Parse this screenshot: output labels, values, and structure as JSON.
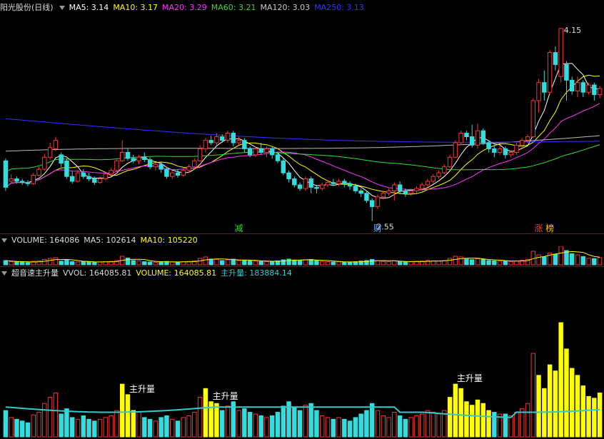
{
  "price_panel": {
    "title": "阳光股份(日线)",
    "ma": [
      {
        "label": "MA5: 3.14",
        "color": "#ffffff"
      },
      {
        "label": "MA10: 3.17",
        "color": "#ffff00"
      },
      {
        "label": "MA20: 3.29",
        "color": "#ff33ff"
      },
      {
        "label": "MA60: 3.21",
        "color": "#33dd33"
      },
      {
        "label": "MA120: 3.03",
        "color": "#cccccc"
      },
      {
        "label": "MA250: 3.13",
        "color": "#3333ff"
      }
    ],
    "high_label": "4.15",
    "low_label": "2.55",
    "markers": [
      {
        "text": "减",
        "color": "#33dd33",
        "idx": 42
      },
      {
        "text": "财",
        "color": "#66aaff",
        "idx": 67
      },
      {
        "text": "涨",
        "color": "#ff4444",
        "idx": 96
      },
      {
        "text": "榜",
        "color": "#ffcc00",
        "idx": 98
      }
    ]
  },
  "volume_panel": {
    "labels": [
      {
        "text": "VOLUME: 164086",
        "color": "#dddddd"
      },
      {
        "text": "MA5: 102614",
        "color": "#dddddd"
      },
      {
        "text": "MA10: 105220",
        "color": "#ffff00"
      }
    ]
  },
  "indicator_panel": {
    "labels": [
      {
        "text": "超音速主升量",
        "color": "#dddddd"
      },
      {
        "text": "VVOL: 164085.81",
        "color": "#dddddd"
      },
      {
        "text": "VOLUME: 164085.81",
        "color": "#ffff00"
      },
      {
        "text": "主升量: 183884.14",
        "color": "#33cccc"
      }
    ],
    "signal_label": "主升量",
    "signal_idx": [
      22,
      37,
      81
    ]
  },
  "chart_data": {
    "type": "candlestick",
    "ohlc": [
      [
        3.05,
        2.83,
        3.07,
        2.8
      ],
      [
        2.88,
        2.9,
        2.94,
        2.86
      ],
      [
        2.9,
        2.88,
        2.92,
        2.86
      ],
      [
        2.88,
        2.87,
        2.9,
        2.85
      ],
      [
        2.87,
        2.86,
        2.89,
        2.84
      ],
      [
        2.86,
        2.93,
        2.95,
        2.85
      ],
      [
        2.93,
        2.98,
        3.0,
        2.92
      ],
      [
        2.98,
        3.08,
        3.11,
        2.97
      ],
      [
        3.08,
        3.16,
        3.2,
        3.06
      ],
      [
        3.15,
        3.22,
        3.25,
        3.13
      ],
      [
        3.1,
        3.03,
        3.12,
        3.0
      ],
      [
        3.05,
        2.92,
        3.07,
        2.9
      ],
      [
        2.92,
        2.88,
        2.96,
        2.86
      ],
      [
        2.88,
        2.95,
        2.97,
        2.87
      ],
      [
        2.95,
        2.92,
        2.98,
        2.9
      ],
      [
        2.92,
        2.9,
        2.95,
        2.88
      ],
      [
        2.9,
        2.87,
        2.92,
        2.85
      ],
      [
        2.87,
        2.9,
        2.92,
        2.86
      ],
      [
        2.9,
        2.94,
        2.96,
        2.89
      ],
      [
        2.94,
        2.97,
        2.99,
        2.92
      ],
      [
        2.97,
        3.05,
        3.07,
        2.96
      ],
      [
        3.05,
        3.12,
        3.22,
        3.04
      ],
      [
        3.12,
        3.07,
        3.15,
        3.05
      ],
      [
        3.07,
        3.05,
        3.1,
        3.03
      ],
      [
        3.05,
        3.08,
        3.1,
        3.02
      ],
      [
        3.08,
        3.06,
        3.12,
        3.04
      ],
      [
        3.06,
        3.0,
        3.08,
        2.98
      ],
      [
        3.0,
        3.02,
        3.04,
        2.97
      ],
      [
        3.02,
        2.98,
        3.04,
        2.95
      ],
      [
        2.98,
        2.92,
        3.0,
        2.9
      ],
      [
        2.92,
        2.95,
        2.97,
        2.9
      ],
      [
        2.95,
        2.93,
        2.98,
        2.91
      ],
      [
        2.93,
        2.97,
        2.99,
        2.92
      ],
      [
        2.97,
        3.0,
        3.02,
        2.95
      ],
      [
        3.0,
        3.05,
        3.07,
        2.98
      ],
      [
        3.05,
        3.15,
        3.18,
        3.04
      ],
      [
        3.15,
        3.22,
        3.24,
        3.12
      ],
      [
        3.22,
        3.2,
        3.26,
        3.18
      ],
      [
        3.2,
        3.25,
        3.28,
        3.18
      ],
      [
        3.25,
        3.22,
        3.27,
        3.2
      ],
      [
        3.22,
        3.28,
        3.3,
        3.2
      ],
      [
        3.28,
        3.2,
        3.3,
        3.17
      ],
      [
        3.2,
        3.22,
        3.25,
        3.18
      ],
      [
        3.22,
        3.15,
        3.24,
        3.12
      ],
      [
        3.15,
        3.1,
        3.17,
        3.08
      ],
      [
        3.1,
        3.15,
        3.17,
        3.08
      ],
      [
        3.15,
        3.12,
        3.2,
        3.1
      ],
      [
        3.12,
        3.15,
        3.17,
        3.08
      ],
      [
        3.15,
        3.1,
        3.17,
        3.07
      ],
      [
        3.1,
        3.05,
        3.12,
        3.03
      ],
      [
        3.05,
        2.95,
        3.07,
        2.93
      ],
      [
        2.95,
        2.9,
        2.97,
        2.87
      ],
      [
        2.9,
        2.85,
        2.92,
        2.83
      ],
      [
        2.85,
        2.82,
        2.87,
        2.8
      ],
      [
        2.82,
        2.9,
        2.92,
        2.8
      ],
      [
        2.9,
        2.83,
        2.92,
        2.78
      ],
      [
        2.83,
        2.82,
        2.85,
        2.78
      ],
      [
        2.82,
        2.85,
        2.87,
        2.8
      ],
      [
        2.85,
        2.87,
        2.89,
        2.83
      ],
      [
        2.87,
        2.86,
        2.9,
        2.84
      ],
      [
        2.86,
        2.88,
        2.9,
        2.84
      ],
      [
        2.88,
        2.86,
        2.9,
        2.83
      ],
      [
        2.86,
        2.84,
        2.88,
        2.81
      ],
      [
        2.84,
        2.8,
        2.86,
        2.78
      ],
      [
        2.8,
        2.78,
        2.82,
        2.75
      ],
      [
        2.78,
        2.72,
        2.8,
        2.7
      ],
      [
        2.72,
        2.67,
        2.74,
        2.55
      ],
      [
        2.67,
        2.75,
        2.77,
        2.65
      ],
      [
        2.75,
        2.78,
        2.8,
        2.73
      ],
      [
        2.78,
        2.8,
        2.82,
        2.76
      ],
      [
        2.8,
        2.85,
        2.87,
        2.72
      ],
      [
        2.85,
        2.8,
        2.88,
        2.77
      ],
      [
        2.8,
        2.78,
        2.82,
        2.75
      ],
      [
        2.78,
        2.8,
        2.82,
        2.76
      ],
      [
        2.8,
        2.82,
        2.84,
        2.78
      ],
      [
        2.82,
        2.85,
        2.87,
        2.8
      ],
      [
        2.85,
        2.88,
        2.9,
        2.83
      ],
      [
        2.88,
        2.92,
        2.94,
        2.86
      ],
      [
        2.92,
        2.95,
        2.97,
        2.9
      ],
      [
        2.95,
        3.0,
        3.02,
        2.94
      ],
      [
        3.0,
        3.08,
        3.1,
        2.99
      ],
      [
        3.08,
        3.2,
        3.22,
        3.07
      ],
      [
        3.2,
        3.28,
        3.3,
        3.18
      ],
      [
        3.28,
        3.25,
        3.3,
        3.22
      ],
      [
        3.25,
        3.18,
        3.35,
        3.16
      ],
      [
        3.18,
        3.3,
        3.36,
        3.15
      ],
      [
        3.3,
        3.2,
        3.32,
        3.18
      ],
      [
        3.2,
        3.15,
        3.22,
        3.12
      ],
      [
        3.15,
        3.12,
        3.18,
        3.08
      ],
      [
        3.12,
        3.15,
        3.18,
        3.1
      ],
      [
        3.15,
        3.1,
        3.17,
        3.07
      ],
      [
        3.1,
        3.12,
        3.14,
        3.08
      ],
      [
        3.12,
        3.18,
        3.2,
        3.1
      ],
      [
        3.18,
        3.22,
        3.24,
        3.16
      ],
      [
        3.22,
        3.25,
        3.27,
        3.2
      ],
      [
        3.25,
        3.55,
        3.57,
        3.24
      ],
      [
        3.55,
        3.7,
        3.73,
        3.45
      ],
      [
        3.7,
        3.62,
        3.8,
        3.55
      ],
      [
        3.62,
        3.95,
        3.97,
        3.6
      ],
      [
        3.95,
        3.85,
        4.0,
        3.8
      ],
      [
        3.75,
        4.15,
        4.15,
        3.7
      ],
      [
        3.85,
        3.72,
        3.88,
        3.55
      ],
      [
        3.72,
        3.63,
        3.75,
        3.6
      ],
      [
        3.63,
        3.7,
        3.75,
        3.58
      ],
      [
        3.7,
        3.62,
        3.72,
        3.58
      ],
      [
        3.62,
        3.68,
        3.7,
        3.6
      ],
      [
        3.68,
        3.6,
        3.7,
        3.55
      ],
      [
        3.6,
        3.65,
        3.67,
        3.57
      ]
    ],
    "volume": [
      30,
      22,
      20,
      18,
      16,
      25,
      28,
      38,
      45,
      50,
      26,
      32,
      22,
      20,
      24,
      20,
      18,
      20,
      22,
      24,
      30,
      60,
      48,
      30,
      28,
      22,
      20,
      18,
      22,
      24,
      20,
      18,
      22,
      24,
      28,
      45,
      55,
      40,
      38,
      30,
      35,
      40,
      30,
      32,
      28,
      26,
      24,
      22,
      24,
      28,
      35,
      40,
      34,
      30,
      36,
      38,
      30,
      24,
      22,
      20,
      22,
      20,
      18,
      22,
      26,
      30,
      38,
      30,
      24,
      22,
      28,
      24,
      20,
      22,
      24,
      26,
      30,
      28,
      26,
      30,
      45,
      60,
      55,
      40,
      36,
      42,
      38,
      30,
      28,
      26,
      26,
      24,
      28,
      32,
      38,
      95,
      70,
      55,
      82,
      75,
      130,
      100,
      78,
      70,
      58,
      46,
      44,
      50
    ],
    "signal_bars": [
      22,
      37,
      81
    ],
    "y_range": [
      2.5,
      4.25
    ]
  }
}
